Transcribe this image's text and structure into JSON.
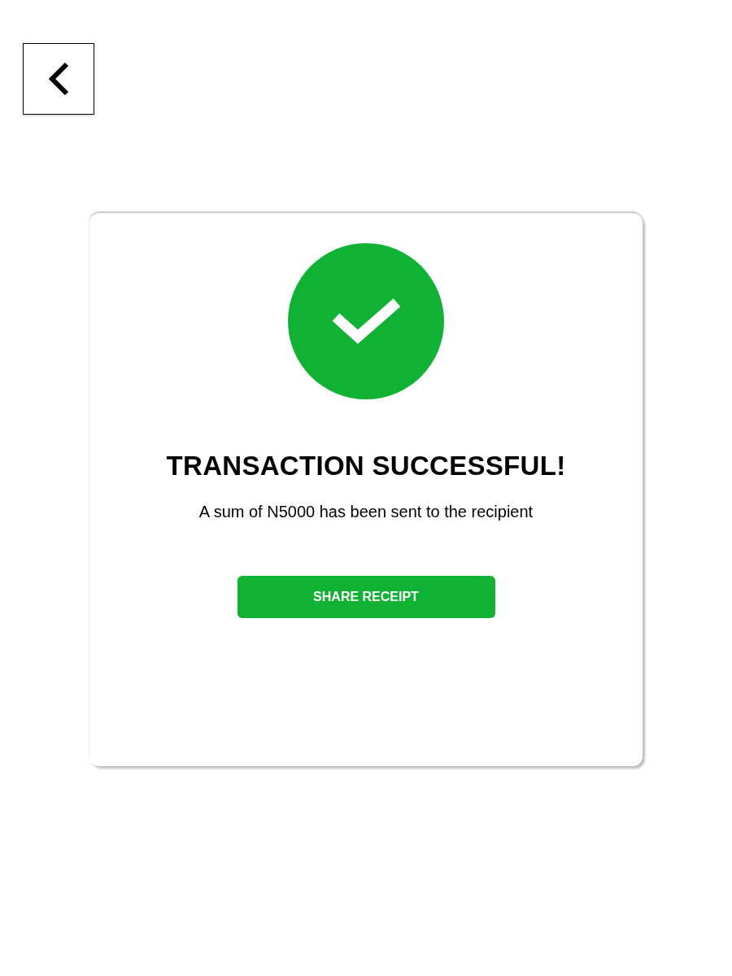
{
  "title": "TRANSACTION SUCCESSFUL!",
  "message": "A sum of N5000 has been sent to the recipient",
  "action": {
    "label": "SHARE RECEIPT"
  }
}
